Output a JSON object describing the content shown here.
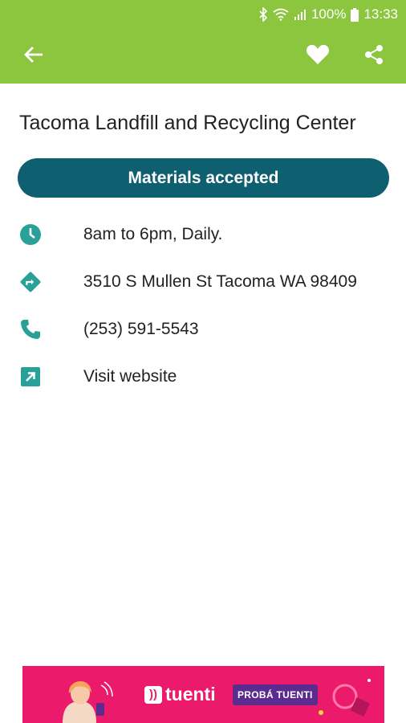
{
  "status_bar": {
    "battery": "100%",
    "time": "13:33"
  },
  "app_bar": {
    "back_icon": "arrow-left",
    "favorite_icon": "heart",
    "share_icon": "share"
  },
  "location": {
    "title": "Tacoma Landfill and Recycling Center",
    "materials_button": "Materials accepted",
    "hours": "8am to 6pm, Daily.",
    "address": "3510 S Mullen St Tacoma WA 98409",
    "phone": "(253) 591-5543",
    "website": "Visit website"
  },
  "ad": {
    "brand": "tuenti",
    "cta": "PROBÁ TUENTI"
  },
  "colors": {
    "app_bar": "#8cc63f",
    "primary": "#0e5f70",
    "icon": "#2aa198",
    "ad_background": "#ec1a6b"
  }
}
